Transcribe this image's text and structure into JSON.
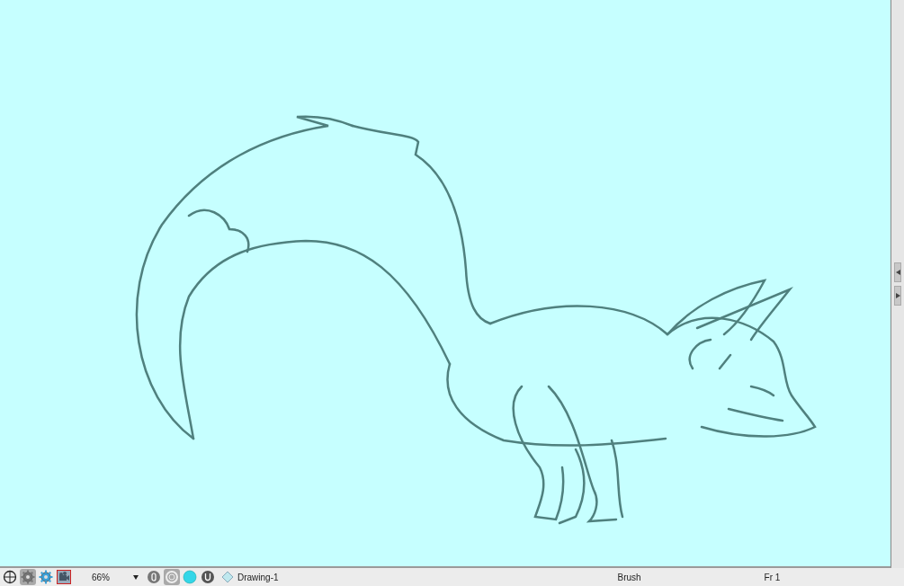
{
  "status_bar": {
    "tool_buttons": [
      {
        "kind": "crosshair",
        "selected": false
      },
      {
        "kind": "gear",
        "selected": true
      },
      {
        "kind": "gear-blue",
        "selected": false
      },
      {
        "kind": "camera",
        "selected": false
      }
    ],
    "zoom": "66%",
    "display_buttons": [
      {
        "kind": "pill",
        "selected": false
      },
      {
        "kind": "ring",
        "selected": true
      },
      {
        "kind": "dot",
        "selected": false
      },
      {
        "kind": "cup",
        "selected": false
      }
    ],
    "layer": "Drawing-1",
    "tool": "Brush",
    "frame": "Fr 1"
  }
}
